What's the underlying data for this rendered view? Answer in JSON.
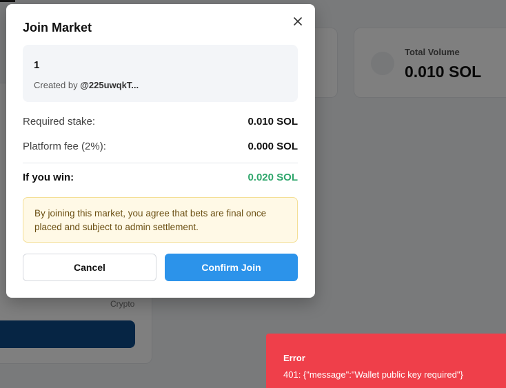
{
  "background": {
    "stat_cards": [
      {
        "label": "",
        "value": ""
      },
      {
        "label": "Total Volume",
        "value": "0.010 SOL"
      }
    ],
    "market_card": {
      "category": "Crypto"
    }
  },
  "modal": {
    "title": "Join Market",
    "close_icon": "close-icon",
    "market": {
      "name": "1",
      "created_by_prefix": "Created by",
      "creator": "@225uwqkT..."
    },
    "rows": {
      "stake": {
        "label": "Required stake:",
        "value": "0.010 SOL"
      },
      "fee": {
        "label": "Platform fee (2%):",
        "value": "0.000 SOL"
      },
      "win": {
        "label": "If you win:",
        "value": "0.020 SOL"
      }
    },
    "notice": "By joining this market, you agree that bets are final once placed and subject to admin settlement.",
    "buttons": {
      "cancel": "Cancel",
      "confirm": "Confirm Join"
    }
  },
  "toast": {
    "title": "Error",
    "message": "401: {\"message\":\"Wallet public key required\"}"
  },
  "colors": {
    "primary": "#2c93ea",
    "win": "#2ea66b",
    "error": "#ef3f4a",
    "notice_bg": "#fff9e6",
    "notice_border": "#f4df96"
  }
}
